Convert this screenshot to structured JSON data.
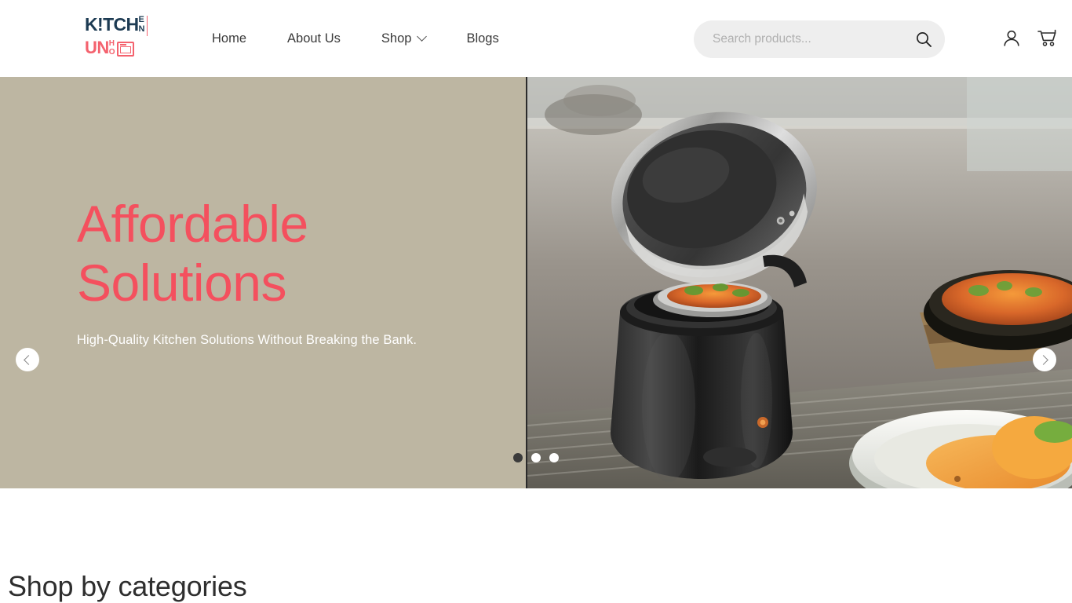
{
  "header": {
    "logo": {
      "word_top": "K!TCH",
      "stack_top_1": "E",
      "stack_top_2": "N",
      "word_bottom": "UN",
      "stack_bottom_1": "H",
      "stack_bottom_2": "O",
      "oven_icon": "microwave-oven-icon",
      "color_navy": "#1d3b53",
      "color_red": "#f4626e"
    },
    "nav": [
      {
        "label": "Home",
        "has_dropdown": false
      },
      {
        "label": "About Us",
        "has_dropdown": false
      },
      {
        "label": "Shop",
        "has_dropdown": true
      },
      {
        "label": "Blogs",
        "has_dropdown": false
      }
    ],
    "search": {
      "placeholder": "Search products...",
      "value": "",
      "icon": "search-icon"
    },
    "icons": [
      {
        "name": "account-icon"
      },
      {
        "name": "cart-icon"
      }
    ]
  },
  "hero": {
    "title": "Affordable Solutions",
    "subtitle": "High-Quality Kitchen Solutions Without Breaking the Bank.",
    "background_color": "#bdb6a2",
    "title_color": "#f4505e",
    "subtitle_color": "#ffffff",
    "image_alt": "Black electric soup kettle warmer with open stainless steel lid containing orange stew with green garnish, bowls of food on a table",
    "prev_label": "Previous slide",
    "next_label": "Next slide",
    "slides": [
      {
        "index": 1,
        "active": true
      },
      {
        "index": 2,
        "active": false
      },
      {
        "index": 3,
        "active": false
      }
    ]
  },
  "categories": {
    "title": "Shop by categories"
  }
}
